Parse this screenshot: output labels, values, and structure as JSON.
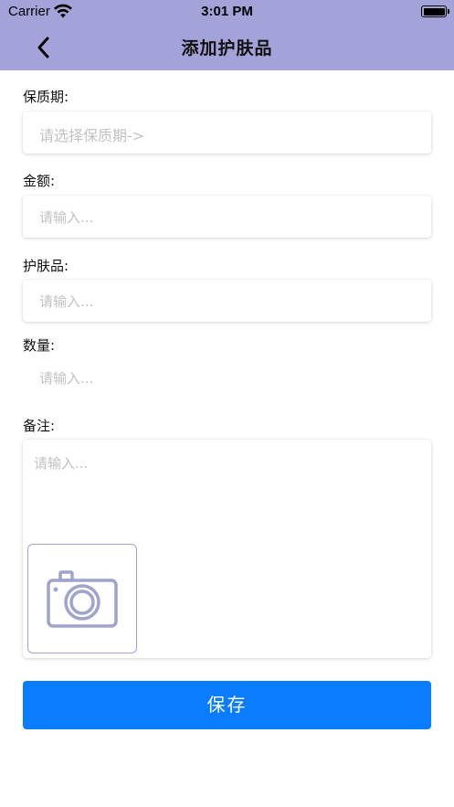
{
  "status_bar": {
    "carrier": "Carrier",
    "time": "3:01 PM"
  },
  "nav": {
    "title": "添加护肤品",
    "back_icon": "chevron-left-icon"
  },
  "form": {
    "expiry": {
      "label": "保质期:",
      "placeholder": "请选择保质期->"
    },
    "amount": {
      "label": "金额:",
      "placeholder": "请输入..."
    },
    "product": {
      "label": "护肤品:",
      "placeholder": "请输入..."
    },
    "quantity": {
      "label": "数量:",
      "placeholder": "请输入..."
    },
    "notes": {
      "label": "备注:",
      "placeholder": "请输入...",
      "photo_icon": "camera-icon"
    }
  },
  "save_button": {
    "label": "保存"
  },
  "colors": {
    "header": "#a3a3d9",
    "primary": "#0a7cff",
    "placeholder": "#c2c2c2",
    "camera": "#9fa4cc"
  }
}
